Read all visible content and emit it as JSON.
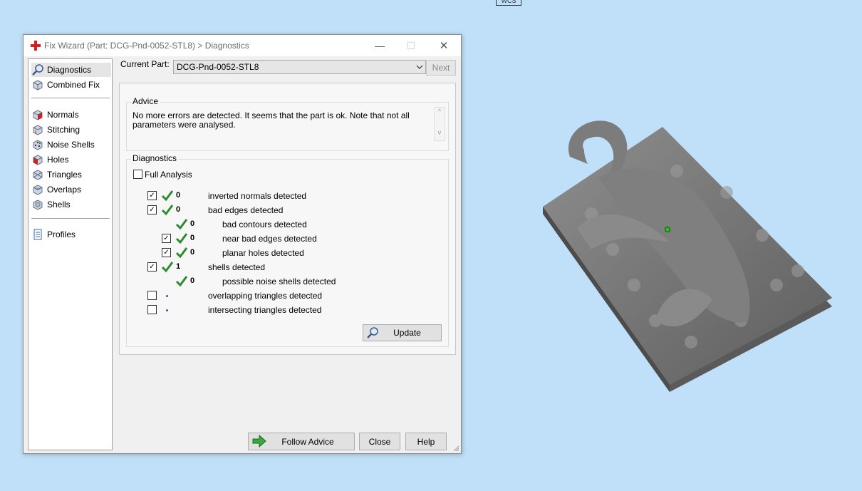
{
  "viewport": {
    "wcs_label": "WCS"
  },
  "window": {
    "title": "Fix Wizard (Part: DCG-Pnd-0052-STL8) > Diagnostics",
    "minimize": "—",
    "maximize": "☐",
    "close": "✕"
  },
  "sidebar": {
    "items": [
      {
        "label": "Diagnostics",
        "icon": "magnifier-icon"
      },
      {
        "label": "Combined Fix",
        "icon": "cube-icon"
      },
      {
        "label": "Normals",
        "icon": "normals-cube-icon"
      },
      {
        "label": "Stitching",
        "icon": "stitching-cube-icon"
      },
      {
        "label": "Noise Shells",
        "icon": "noise-shells-icon"
      },
      {
        "label": "Holes",
        "icon": "holes-cube-icon"
      },
      {
        "label": "Triangles",
        "icon": "triangles-cube-icon"
      },
      {
        "label": "Overlaps",
        "icon": "overlaps-cube-icon"
      },
      {
        "label": "Shells",
        "icon": "shells-cube-icon"
      },
      {
        "label": "Profiles",
        "icon": "document-icon"
      }
    ]
  },
  "current_part": {
    "label": "Current Part:",
    "value": "DCG-Pnd-0052-STL8"
  },
  "next_button": "Next",
  "advice": {
    "title": "Advice",
    "text": "No more errors are detected. It seems that the part is ok. Note that not all parameters were analysed.",
    "scroll_up": "^",
    "scroll_down": "v"
  },
  "diagnostics": {
    "title": "Diagnostics",
    "full_analysis": "Full Analysis",
    "rows": [
      {
        "count": "0",
        "label": "inverted normals detected",
        "checked": true
      },
      {
        "count": "0",
        "label": "bad edges detected",
        "checked": true
      },
      {
        "count": "0",
        "label": "bad contours detected"
      },
      {
        "count": "0",
        "label": "near bad edges detected",
        "checked": true
      },
      {
        "count": "0",
        "label": "planar holes detected",
        "checked": true
      },
      {
        "count": "1",
        "label": "shells detected",
        "checked": true
      },
      {
        "count": "0",
        "label": "possible noise shells detected"
      },
      {
        "label": "overlapping triangles detected",
        "checked": false
      },
      {
        "label": "intersecting triangles detected",
        "checked": false
      }
    ],
    "check_mark": "✓"
  },
  "buttons": {
    "update": "Update",
    "follow_advice": "Follow Advice",
    "close": "Close",
    "help": "Help"
  },
  "colors": {
    "tick_green": "#2e8b2e",
    "title_icon_red": "#d21f1f",
    "background": "#bfe0f8"
  }
}
